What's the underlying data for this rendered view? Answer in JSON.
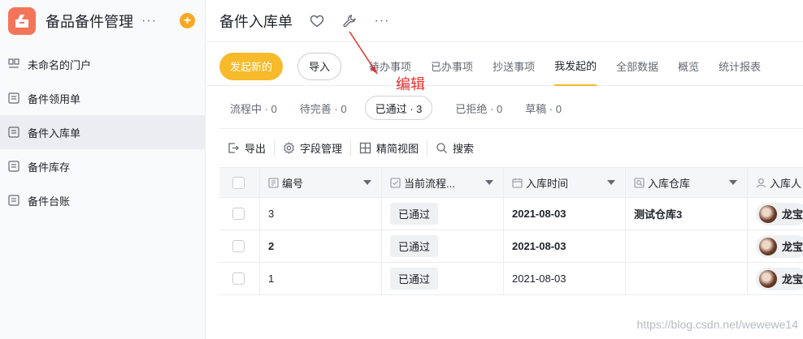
{
  "app": {
    "title": "备品备件管理",
    "more": "···",
    "add": "+"
  },
  "sidebar": {
    "items": [
      {
        "label": "未命名的门户",
        "icon": "portal-icon"
      },
      {
        "label": "备件领用单",
        "icon": "form-icon"
      },
      {
        "label": "备件入库单",
        "icon": "form-icon",
        "active": true
      },
      {
        "label": "备件库存",
        "icon": "form-icon"
      },
      {
        "label": "备件台账",
        "icon": "form-icon"
      }
    ]
  },
  "header": {
    "title": "备件入库单",
    "more": "···"
  },
  "actions": {
    "new_label": "发起新的",
    "import_label": "导入"
  },
  "tabs": [
    "待办事项",
    "已办事项",
    "抄送事项",
    "我发起的",
    "全部数据",
    "概览",
    "统计报表"
  ],
  "active_tab": "我发起的",
  "statuses": [
    {
      "label": "流程中 · 0"
    },
    {
      "label": "待完善 · 0"
    },
    {
      "label": "已通过 · 3",
      "active": true
    },
    {
      "label": "已拒绝 · 0"
    },
    {
      "label": "草稿 · 0"
    }
  ],
  "annotation": "编辑",
  "toolbar": {
    "export": "导出",
    "fields": "字段管理",
    "compact": "精简视图",
    "search": "搜索"
  },
  "table": {
    "columns": [
      "编号",
      "当前流程...",
      "入库时间",
      "入库仓库",
      "入库人"
    ],
    "rows": [
      {
        "num": "3",
        "flow": "已通过",
        "time": "2021-08-03",
        "store": "测试仓库3",
        "user": "龙宝"
      },
      {
        "num": "2",
        "flow": "已通过",
        "time": "2021-08-03",
        "store": "",
        "user": "龙宝"
      },
      {
        "num": "1",
        "flow": "已通过",
        "time": "2021-08-03",
        "store": "",
        "user": "龙宝"
      }
    ]
  },
  "watermark": "https://blog.csdn.net/wewewe14",
  "colors": {
    "accent": "#f7ba2a",
    "logo": "#f4745a",
    "annotation": "#e8302c"
  }
}
